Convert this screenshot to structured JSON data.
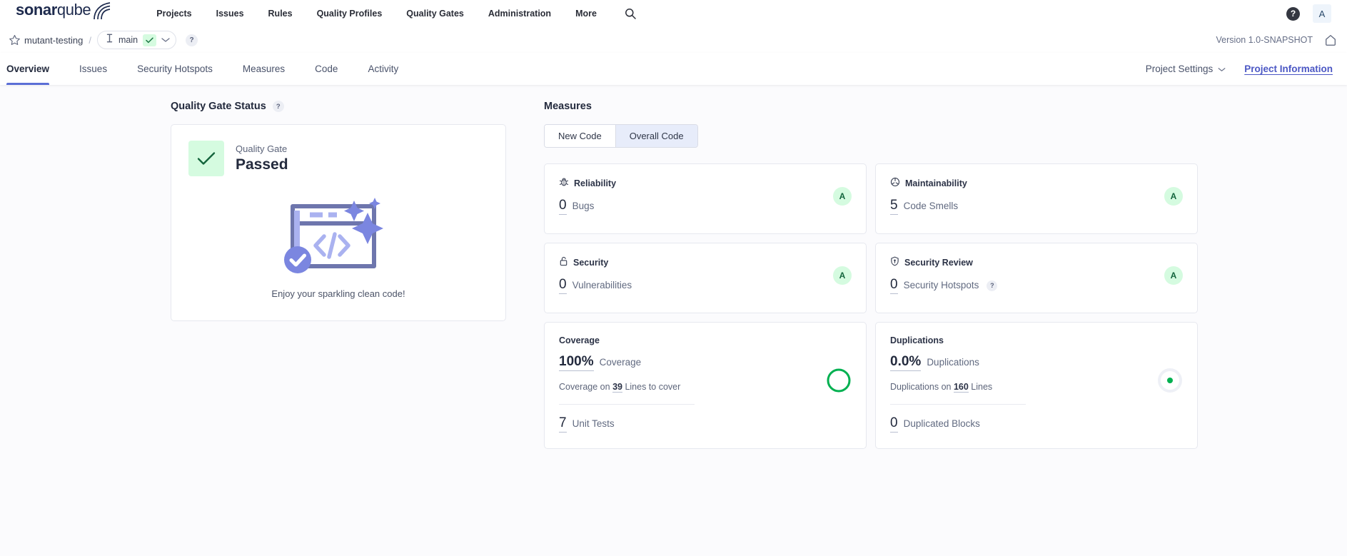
{
  "global_nav": {
    "logo_bold": "sonar",
    "logo_light": "qube",
    "items": [
      {
        "label": "Projects"
      },
      {
        "label": "Issues"
      },
      {
        "label": "Rules"
      },
      {
        "label": "Quality Profiles"
      },
      {
        "label": "Quality Gates"
      },
      {
        "label": "Administration"
      },
      {
        "label": "More"
      }
    ],
    "search_icon": "search-icon",
    "help_label": "?",
    "avatar_label": "A"
  },
  "breadcrumb": {
    "star_icon": "star-icon",
    "project_name": "mutant-testing",
    "separator": "/",
    "branch_icon": "branch-icon",
    "branch_name": "main",
    "branch_status_icon": "check-icon",
    "branch_dropdown_icon": "chevron-down-icon",
    "help_label": "?",
    "version": "Version 1.0-SNAPSHOT",
    "home_icon": "home-icon"
  },
  "tabs": {
    "items": [
      {
        "label": "Overview",
        "active": true
      },
      {
        "label": "Issues",
        "active": false
      },
      {
        "label": "Security Hotspots",
        "active": false
      },
      {
        "label": "Measures",
        "active": false
      },
      {
        "label": "Code",
        "active": false
      },
      {
        "label": "Activity",
        "active": false
      }
    ],
    "project_settings": "Project Settings",
    "project_settings_icon": "chevron-down-icon",
    "project_information": "Project Information"
  },
  "quality_gate": {
    "section_title": "Quality Gate Status",
    "help_label": "?",
    "badge_icon": "check-icon",
    "label": "Quality Gate",
    "status": "Passed",
    "illustration": "clean-code-illustration",
    "caption": "Enjoy your sparkling clean code!"
  },
  "measures": {
    "section_title": "Measures",
    "toggle": {
      "options": [
        {
          "label": "New Code",
          "selected": false
        },
        {
          "label": "Overall Code",
          "selected": true
        }
      ]
    },
    "cards": [
      {
        "name": "reliability",
        "icon": "bug-icon",
        "title": "Reliability",
        "value": "0",
        "unit": "Bugs",
        "rating": "A"
      },
      {
        "name": "maintainability",
        "icon": "code-smell-icon",
        "title": "Maintainability",
        "value": "5",
        "unit": "Code Smells",
        "rating": "A"
      },
      {
        "name": "security",
        "icon": "lock-icon",
        "title": "Security",
        "value": "0",
        "unit": "Vulnerabilities",
        "rating": "A"
      },
      {
        "name": "security-review",
        "icon": "shield-icon",
        "title": "Security Review",
        "value": "0",
        "unit": "Security Hotspots",
        "unit_help": "?",
        "rating": "A"
      }
    ],
    "coverage": {
      "title": "Coverage",
      "value": "100%",
      "unit": "Coverage",
      "sub_prefix": "Coverage on",
      "sub_value": "39",
      "sub_suffix": "Lines to cover",
      "footer_value": "7",
      "footer_unit": "Unit Tests",
      "indicator": "coverage-donut"
    },
    "duplications": {
      "title": "Duplications",
      "value": "0.0%",
      "unit": "Duplications",
      "sub_prefix": "Duplications on",
      "sub_value": "160",
      "sub_suffix": "Lines",
      "footer_value": "0",
      "footer_unit": "Duplicated Blocks",
      "indicator": "duplications-dot"
    }
  },
  "colors": {
    "accent": "#4b57c4",
    "success": "#00b050",
    "success_bg": "#d5fbe0",
    "success_text": "#14653d",
    "tab_underline": "#5b6ed6",
    "illustration": "#7b86e0"
  }
}
